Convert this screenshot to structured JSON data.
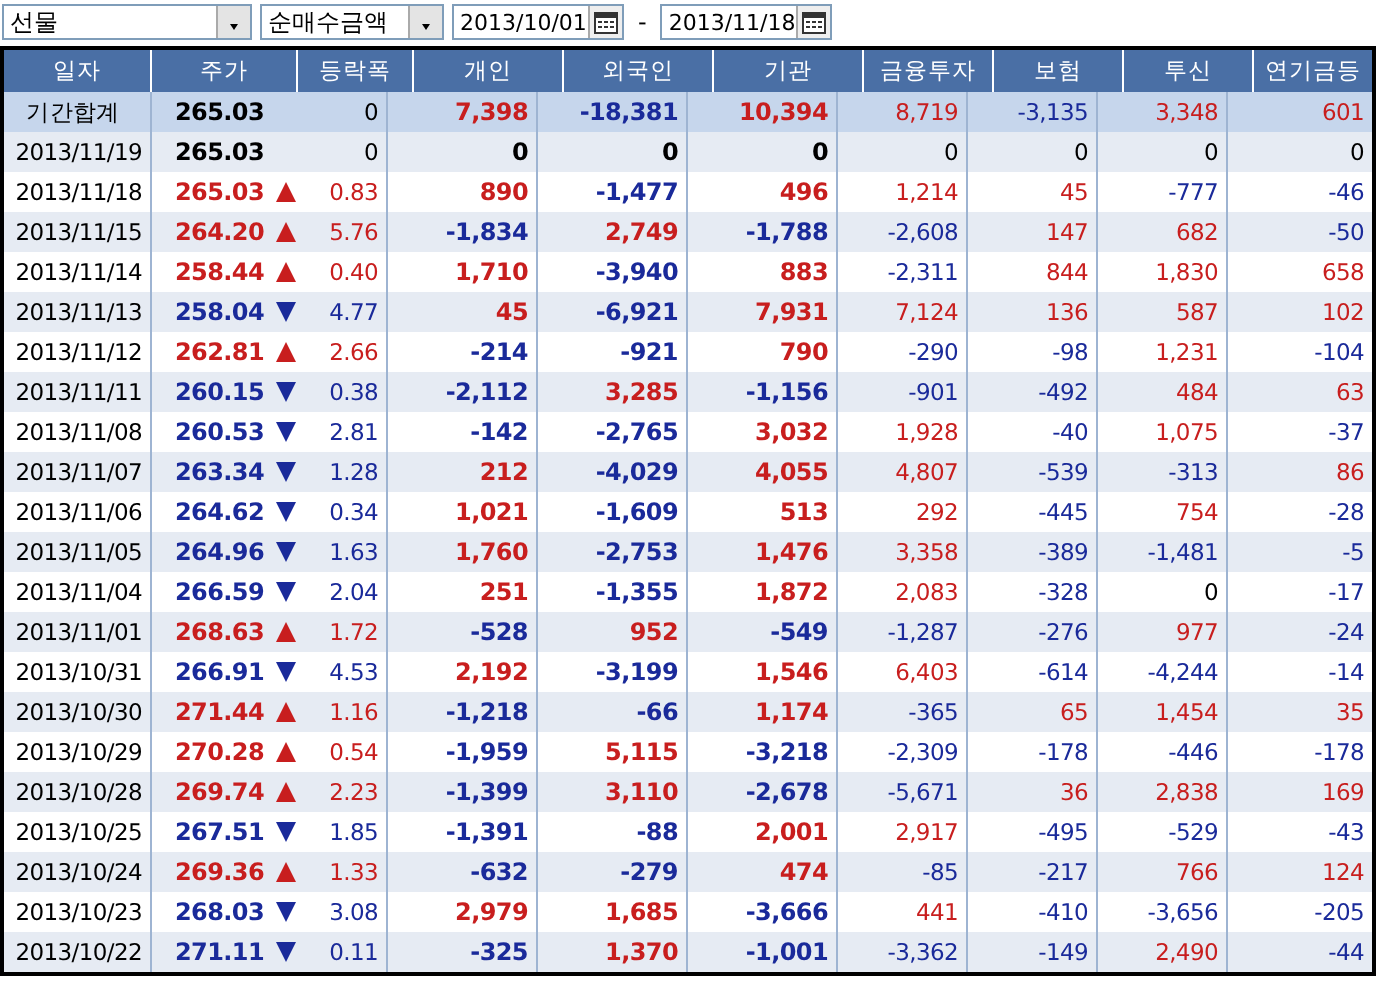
{
  "toolbar": {
    "market_select": "선물",
    "value_select": "순매수금액",
    "date_from": "2013/10/01",
    "date_separator": "-",
    "date_to": "2013/11/18"
  },
  "table": {
    "columns": [
      "일자",
      "주가",
      "등락폭",
      "개인",
      "외국인",
      "기관",
      "금융투자",
      "보험",
      "투신",
      "연기금등"
    ],
    "rows": [
      {
        "kind": "summary",
        "date": "기간합계",
        "price": "265.03",
        "up": false,
        "down": false,
        "change": "0",
        "values": [
          "7,398",
          "-18,381",
          "10,394",
          "8,719",
          "-3,135",
          "3,348",
          "601"
        ]
      },
      {
        "kind": "day",
        "date": "2013/11/19",
        "price": "265.03",
        "up": false,
        "down": false,
        "change": "0",
        "values": [
          "0",
          "0",
          "0",
          "0",
          "0",
          "0",
          "0"
        ]
      },
      {
        "kind": "day",
        "date": "2013/11/18",
        "price": "265.03",
        "up": true,
        "down": false,
        "change": "0.83",
        "values": [
          "890",
          "-1,477",
          "496",
          "1,214",
          "45",
          "-777",
          "-46"
        ]
      },
      {
        "kind": "day",
        "date": "2013/11/15",
        "price": "264.20",
        "up": true,
        "down": false,
        "change": "5.76",
        "values": [
          "-1,834",
          "2,749",
          "-1,788",
          "-2,608",
          "147",
          "682",
          "-50"
        ]
      },
      {
        "kind": "day",
        "date": "2013/11/14",
        "price": "258.44",
        "up": true,
        "down": false,
        "change": "0.40",
        "values": [
          "1,710",
          "-3,940",
          "883",
          "-2,311",
          "844",
          "1,830",
          "658"
        ]
      },
      {
        "kind": "day",
        "date": "2013/11/13",
        "price": "258.04",
        "up": false,
        "down": true,
        "change": "4.77",
        "values": [
          "45",
          "-6,921",
          "7,931",
          "7,124",
          "136",
          "587",
          "102"
        ]
      },
      {
        "kind": "day",
        "date": "2013/11/12",
        "price": "262.81",
        "up": true,
        "down": false,
        "change": "2.66",
        "values": [
          "-214",
          "-921",
          "790",
          "-290",
          "-98",
          "1,231",
          "-104"
        ]
      },
      {
        "kind": "day",
        "date": "2013/11/11",
        "price": "260.15",
        "up": false,
        "down": true,
        "change": "0.38",
        "values": [
          "-2,112",
          "3,285",
          "-1,156",
          "-901",
          "-492",
          "484",
          "63"
        ]
      },
      {
        "kind": "day",
        "date": "2013/11/08",
        "price": "260.53",
        "up": false,
        "down": true,
        "change": "2.81",
        "values": [
          "-142",
          "-2,765",
          "3,032",
          "1,928",
          "-40",
          "1,075",
          "-37"
        ]
      },
      {
        "kind": "day",
        "date": "2013/11/07",
        "price": "263.34",
        "up": false,
        "down": true,
        "change": "1.28",
        "values": [
          "212",
          "-4,029",
          "4,055",
          "4,807",
          "-539",
          "-313",
          "86"
        ]
      },
      {
        "kind": "day",
        "date": "2013/11/06",
        "price": "264.62",
        "up": false,
        "down": true,
        "change": "0.34",
        "values": [
          "1,021",
          "-1,609",
          "513",
          "292",
          "-445",
          "754",
          "-28"
        ]
      },
      {
        "kind": "day",
        "date": "2013/11/05",
        "price": "264.96",
        "up": false,
        "down": true,
        "change": "1.63",
        "values": [
          "1,760",
          "-2,753",
          "1,476",
          "3,358",
          "-389",
          "-1,481",
          "-5"
        ]
      },
      {
        "kind": "day",
        "date": "2013/11/04",
        "price": "266.59",
        "up": false,
        "down": true,
        "change": "2.04",
        "values": [
          "251",
          "-1,355",
          "1,872",
          "2,083",
          "-328",
          "0",
          "-17"
        ]
      },
      {
        "kind": "day",
        "date": "2013/11/01",
        "price": "268.63",
        "up": true,
        "down": false,
        "change": "1.72",
        "values": [
          "-528",
          "952",
          "-549",
          "-1,287",
          "-276",
          "977",
          "-24"
        ]
      },
      {
        "kind": "day",
        "date": "2013/10/31",
        "price": "266.91",
        "up": false,
        "down": true,
        "change": "4.53",
        "values": [
          "2,192",
          "-3,199",
          "1,546",
          "6,403",
          "-614",
          "-4,244",
          "-14"
        ]
      },
      {
        "kind": "day",
        "date": "2013/10/30",
        "price": "271.44",
        "up": true,
        "down": false,
        "change": "1.16",
        "values": [
          "-1,218",
          "-66",
          "1,174",
          "-365",
          "65",
          "1,454",
          "35"
        ]
      },
      {
        "kind": "day",
        "date": "2013/10/29",
        "price": "270.28",
        "up": true,
        "down": false,
        "change": "0.54",
        "values": [
          "-1,959",
          "5,115",
          "-3,218",
          "-2,309",
          "-178",
          "-446",
          "-178"
        ]
      },
      {
        "kind": "day",
        "date": "2013/10/28",
        "price": "269.74",
        "up": true,
        "down": false,
        "change": "2.23",
        "values": [
          "-1,399",
          "3,110",
          "-2,678",
          "-5,671",
          "36",
          "2,838",
          "169"
        ]
      },
      {
        "kind": "day",
        "date": "2013/10/25",
        "price": "267.51",
        "up": false,
        "down": true,
        "change": "1.85",
        "values": [
          "-1,391",
          "-88",
          "2,001",
          "2,917",
          "-495",
          "-529",
          "-43"
        ]
      },
      {
        "kind": "day",
        "date": "2013/10/24",
        "price": "269.36",
        "up": true,
        "down": false,
        "change": "1.33",
        "values": [
          "-632",
          "-279",
          "474",
          "-85",
          "-217",
          "766",
          "124"
        ]
      },
      {
        "kind": "day",
        "date": "2013/10/23",
        "price": "268.03",
        "up": false,
        "down": true,
        "change": "3.08",
        "values": [
          "2,979",
          "1,685",
          "-3,666",
          "441",
          "-410",
          "-3,656",
          "-205"
        ]
      },
      {
        "kind": "day",
        "date": "2013/10/22",
        "price": "271.11",
        "up": false,
        "down": true,
        "change": "0.11",
        "values": [
          "-325",
          "1,370",
          "-1,001",
          "-3,362",
          "-149",
          "2,490",
          "-44"
        ]
      }
    ]
  }
}
